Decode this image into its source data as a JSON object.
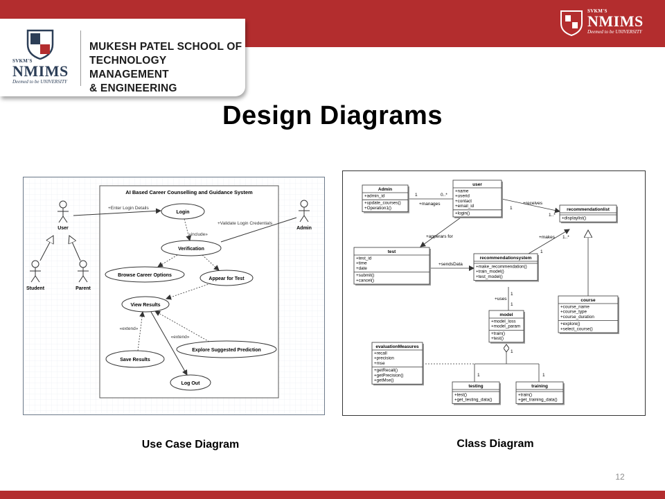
{
  "header": {
    "school_name_lines": [
      "MUKESH PATEL SCHOOL OF",
      "TECHNOLOGY MANAGEMENT",
      "& ENGINEERING"
    ],
    "brand": {
      "prefix": "SVKM'S",
      "name": "NMIMS",
      "tagline": "Deemed to be UNIVERSITY"
    }
  },
  "slide": {
    "title": "Design Diagrams",
    "left_caption": "Use Case Diagram",
    "right_caption": "Class Diagram",
    "page_number": "12"
  },
  "colors": {
    "brand_red": "#b32d2e",
    "logo_dark": "#2c3e57"
  },
  "use_case": {
    "system_title": "AI Based Career Counselling and Guidance System",
    "actors": {
      "user": "User",
      "admin": "Admin",
      "student": "Student",
      "parent": "Parent"
    },
    "cases": {
      "login": "Login",
      "verification": "Verification",
      "browse": "Browse Career Options",
      "appear": "Appear for Test",
      "view": "View Results",
      "explore": "Explore Suggested Prediction",
      "save": "Save Results",
      "logout": "Log Out"
    },
    "labels": {
      "enter_login": "+Enter Login Details",
      "validate": "+Validate Login Credentials",
      "include": "«include»",
      "extend1": "«extend»",
      "extend2": "«extend»"
    }
  },
  "class_diagram": {
    "admin": {
      "name": "Admin",
      "attrs": [
        "+admin_id"
      ],
      "ops": [
        "+update_courses()",
        "+Operation1()"
      ]
    },
    "user": {
      "name": "user",
      "attrs": [
        "+name",
        "+userid",
        "+contact",
        "+email_id"
      ],
      "ops": [
        "+login()"
      ]
    },
    "recommendationlist": {
      "name": "recommendationlist",
      "attrs": [],
      "ops": [
        "+displaylist()"
      ]
    },
    "test": {
      "name": "test",
      "attrs": [
        "+test_id",
        "+time",
        "+date"
      ],
      "ops": [
        "+submit()",
        "+cancel()"
      ]
    },
    "recommendationsystem": {
      "name": "recommendationsystem",
      "attrs": [],
      "ops": [
        "+make_recommendation()",
        "+train_model()",
        "+test_model()"
      ]
    },
    "course": {
      "name": "course",
      "attrs": [
        "+course_name",
        "+course_type",
        "+course_duration"
      ],
      "ops": [
        "+explore()",
        "+select_course()"
      ]
    },
    "model": {
      "name": "model",
      "attrs": [
        "+model_loss",
        "+model_param"
      ],
      "ops": [
        "+train()",
        "+test()"
      ]
    },
    "evaluationMeasures": {
      "name": "evaluationMeasures",
      "attrs": [
        "+recall",
        "+precision",
        "+mse"
      ],
      "ops": [
        "+getRecall()",
        "+getPrecision()",
        "+getMse()"
      ]
    },
    "testing": {
      "name": "testing",
      "attrs": [],
      "ops": [
        "+test()",
        "+get_testing_data()"
      ]
    },
    "training": {
      "name": "training",
      "attrs": [],
      "ops": [
        "+train()",
        "+get_training_data()"
      ]
    },
    "relations": {
      "manages": "+manages",
      "receives": "+receives",
      "appears_for": "+apperars for",
      "makes": "+makes",
      "sends_data": "+sendsData",
      "uses": "+uses"
    },
    "multiplicities": {
      "admin_user_1": "1",
      "admin_user_many": "0..*",
      "user_rl_1": "1",
      "user_rl_many": "1..*",
      "rs_rl_1": "1",
      "rs_rl_many": "1..*",
      "rs_model_1a": "1",
      "rs_model_1b": "1",
      "model_div_1": "1",
      "testing_1": "1",
      "training_1": "1"
    }
  }
}
